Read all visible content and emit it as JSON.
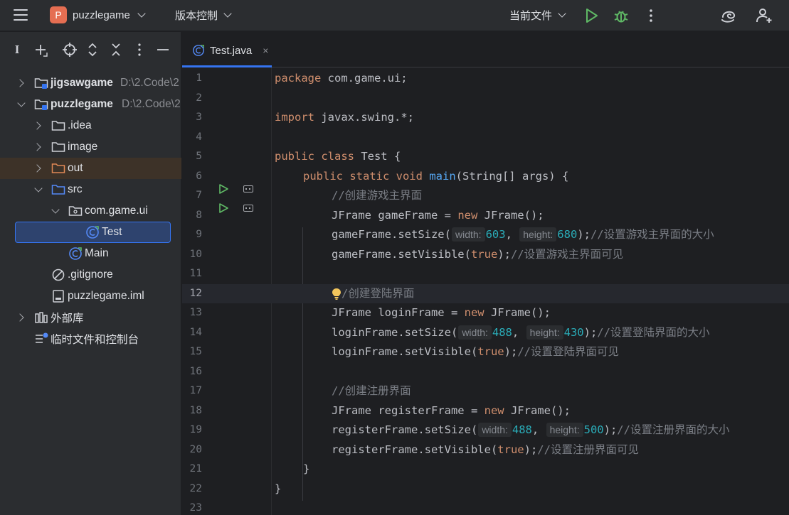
{
  "titlebar": {
    "project_badge": "P",
    "project_name": "puzzlegame",
    "vcs_label": "版本控制",
    "run_config": "当前文件",
    "accent": "#3574f0"
  },
  "sidebar": {
    "tool_i": "I",
    "tree": [
      {
        "label": "jigsawgame",
        "path": "D:\\2.Code\\2"
      },
      {
        "label": "puzzlegame",
        "path": "D:\\2.Code\\2"
      },
      {
        "label": ".idea"
      },
      {
        "label": "image"
      },
      {
        "label": "out"
      },
      {
        "label": "src"
      },
      {
        "label": "com.game.ui"
      },
      {
        "label": "Test"
      },
      {
        "label": "Main"
      },
      {
        "label": ".gitignore"
      },
      {
        "label": "puzzlegame.iml"
      },
      {
        "label": "外部库"
      },
      {
        "label": "临时文件和控制台"
      }
    ]
  },
  "editor": {
    "tab_label": "Test.java",
    "tab_close": "×",
    "line_numbers": [
      "1",
      "2",
      "3",
      "4",
      "5",
      "6",
      "7",
      "8",
      "9",
      "10",
      "11",
      "12",
      "13",
      "14",
      "15",
      "16",
      "17",
      "18",
      "19",
      "20",
      "21",
      "22",
      "23"
    ],
    "code": {
      "l1_kw": "package",
      "l1_rest": " com.game.ui;",
      "l3_kw": "import",
      "l3_rest": " javax.swing.*;",
      "l5_kw": "public class",
      "l5_rest": " Test {",
      "l6_kw": "public static void",
      "l6_fn": "main",
      "l6_rest": "(String[] args) {",
      "l7_cm": "//创建游戏主界面",
      "l8_a": "JFrame gameFrame = ",
      "l8_kw": "new",
      "l8_b": " JFrame();",
      "l9_a": "gameFrame.setSize(",
      "l9_h1": "width:",
      "l9_v1": "603",
      "l9_h2": "height:",
      "l9_v2": "680",
      "l9_b": ");",
      "l9_cm": "//设置游戏主界面的大小",
      "l10_a": "gameFrame.setVisible(",
      "l10_kw": "true",
      "l10_b": ");",
      "l10_cm": "//设置游戏主界面可见",
      "l12_cm": "/创建登陆界面",
      "l13_a": "JFrame loginFrame = ",
      "l13_kw": "new",
      "l13_b": " JFrame();",
      "l14_a": "loginFrame.setSize(",
      "l14_h1": "width:",
      "l14_v1": "488",
      "l14_h2": "height:",
      "l14_v2": "430",
      "l14_b": ");",
      "l14_cm": "//设置登陆界面的大小",
      "l15_a": "loginFrame.setVisible(",
      "l15_kw": "true",
      "l15_b": ");",
      "l15_cm": "//设置登陆界面可见",
      "l17_cm": "//创建注册界面",
      "l18_a": "JFrame registerFrame = ",
      "l18_kw": "new",
      "l18_b": " JFrame();",
      "l19_a": "registerFrame.setSize(",
      "l19_h1": "width:",
      "l19_v1": "488",
      "l19_h2": "height:",
      "l19_v2": "500",
      "l19_b": ");",
      "l19_cm": "//设置注册界面的大小",
      "l20_a": "registerFrame.setVisible(",
      "l20_kw": "true",
      "l20_b": ");",
      "l20_cm": "//设置注册界面可见",
      "l21": "}",
      "l22": "}"
    }
  }
}
